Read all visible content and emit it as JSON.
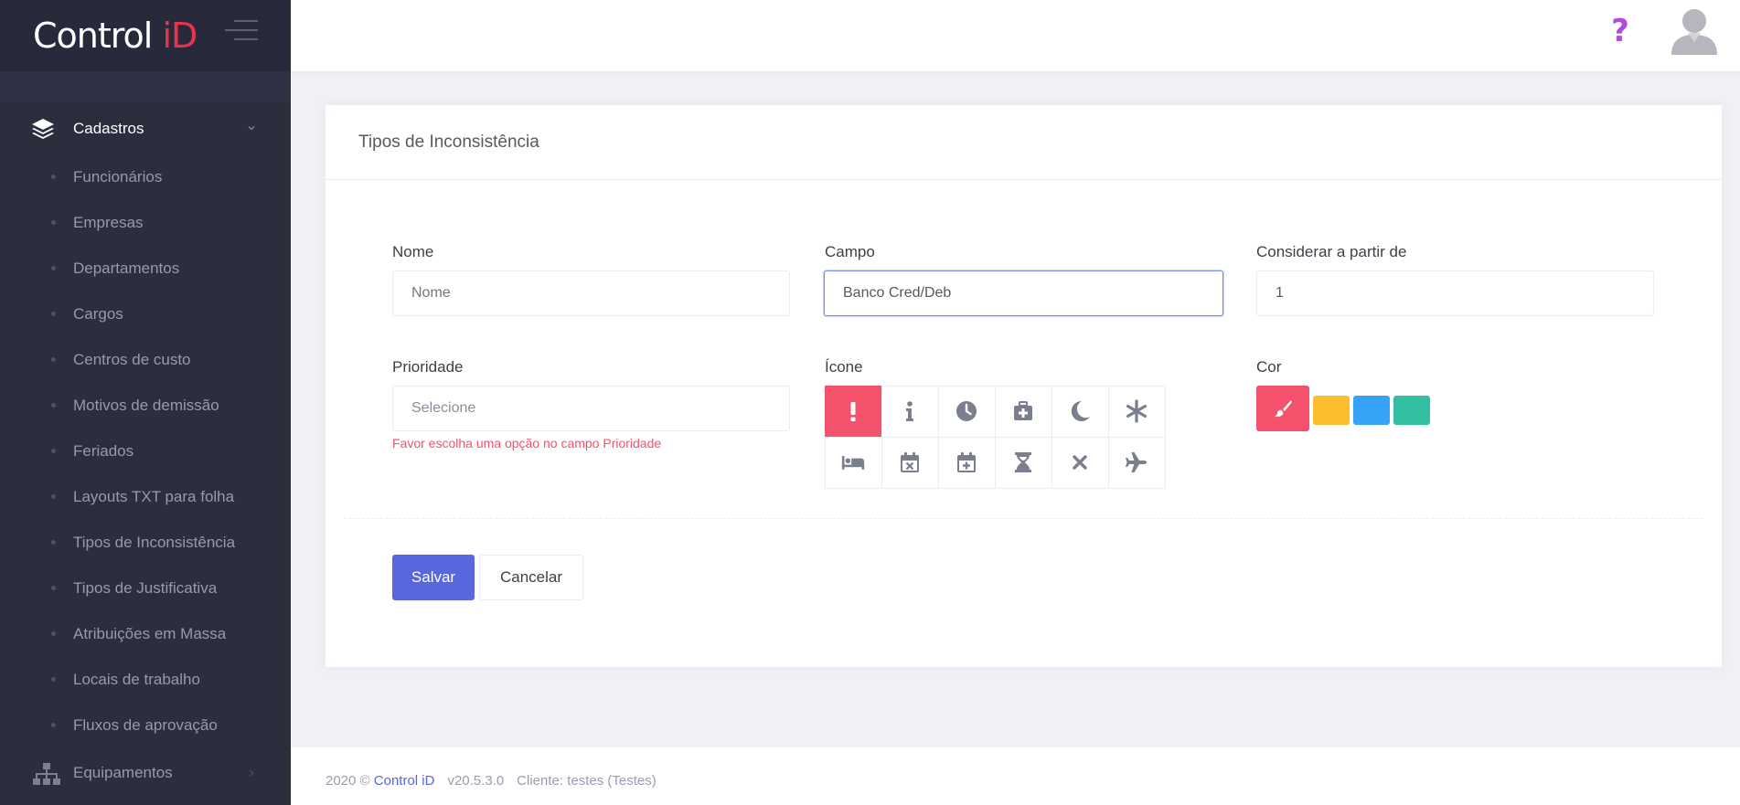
{
  "brand": {
    "name_part1": "Control ",
    "name_part2": "iD"
  },
  "sidebar": {
    "section": {
      "label": "Cadastros",
      "icon": "layers-icon"
    },
    "items": [
      {
        "label": "Funcionários"
      },
      {
        "label": "Empresas"
      },
      {
        "label": "Departamentos"
      },
      {
        "label": "Cargos"
      },
      {
        "label": "Centros de custo"
      },
      {
        "label": "Motivos de demissão"
      },
      {
        "label": "Feriados"
      },
      {
        "label": "Layouts TXT para folha"
      },
      {
        "label": "Tipos de Inconsistência"
      },
      {
        "label": "Tipos de Justificativa"
      },
      {
        "label": "Atribuições em Massa"
      },
      {
        "label": "Locais de trabalho"
      },
      {
        "label": "Fluxos de aprovação"
      }
    ],
    "equipamentos": {
      "label": "Equipamentos",
      "icon": "sitemap-icon"
    }
  },
  "topbar": {
    "help": "?"
  },
  "card": {
    "title": "Tipos de Inconsistência"
  },
  "form": {
    "nome": {
      "label": "Nome",
      "placeholder": "Nome",
      "value": ""
    },
    "campo": {
      "label": "Campo",
      "value": "Banco Cred/Deb"
    },
    "considerar": {
      "label": "Considerar a partir de",
      "value": "1"
    },
    "prioridade": {
      "label": "Prioridade",
      "placeholder": "Selecione",
      "error": "Favor escolha uma opção no campo Prioridade"
    },
    "icone": {
      "label": "Ícone",
      "selected": "exclamation-icon",
      "icons": [
        "exclamation-icon",
        "info-icon",
        "clock-icon",
        "medkit-icon",
        "moon-icon",
        "asterisk-icon",
        "bed-icon",
        "calendar-x-icon",
        "calendar-plus-icon",
        "hourglass-icon",
        "times-icon",
        "plane-icon"
      ]
    },
    "cor": {
      "label": "Cor",
      "selected": "#f4516c",
      "swatches": [
        "#fbbc2d",
        "#36a3f7",
        "#34bfa3"
      ]
    }
  },
  "buttons": {
    "save": "Salvar",
    "cancel": "Cancelar"
  },
  "footer": {
    "copyright": "2020 ©",
    "brand": "Control iD",
    "version": "v20.5.3.0",
    "client": "Cliente: testes (Testes)"
  }
}
